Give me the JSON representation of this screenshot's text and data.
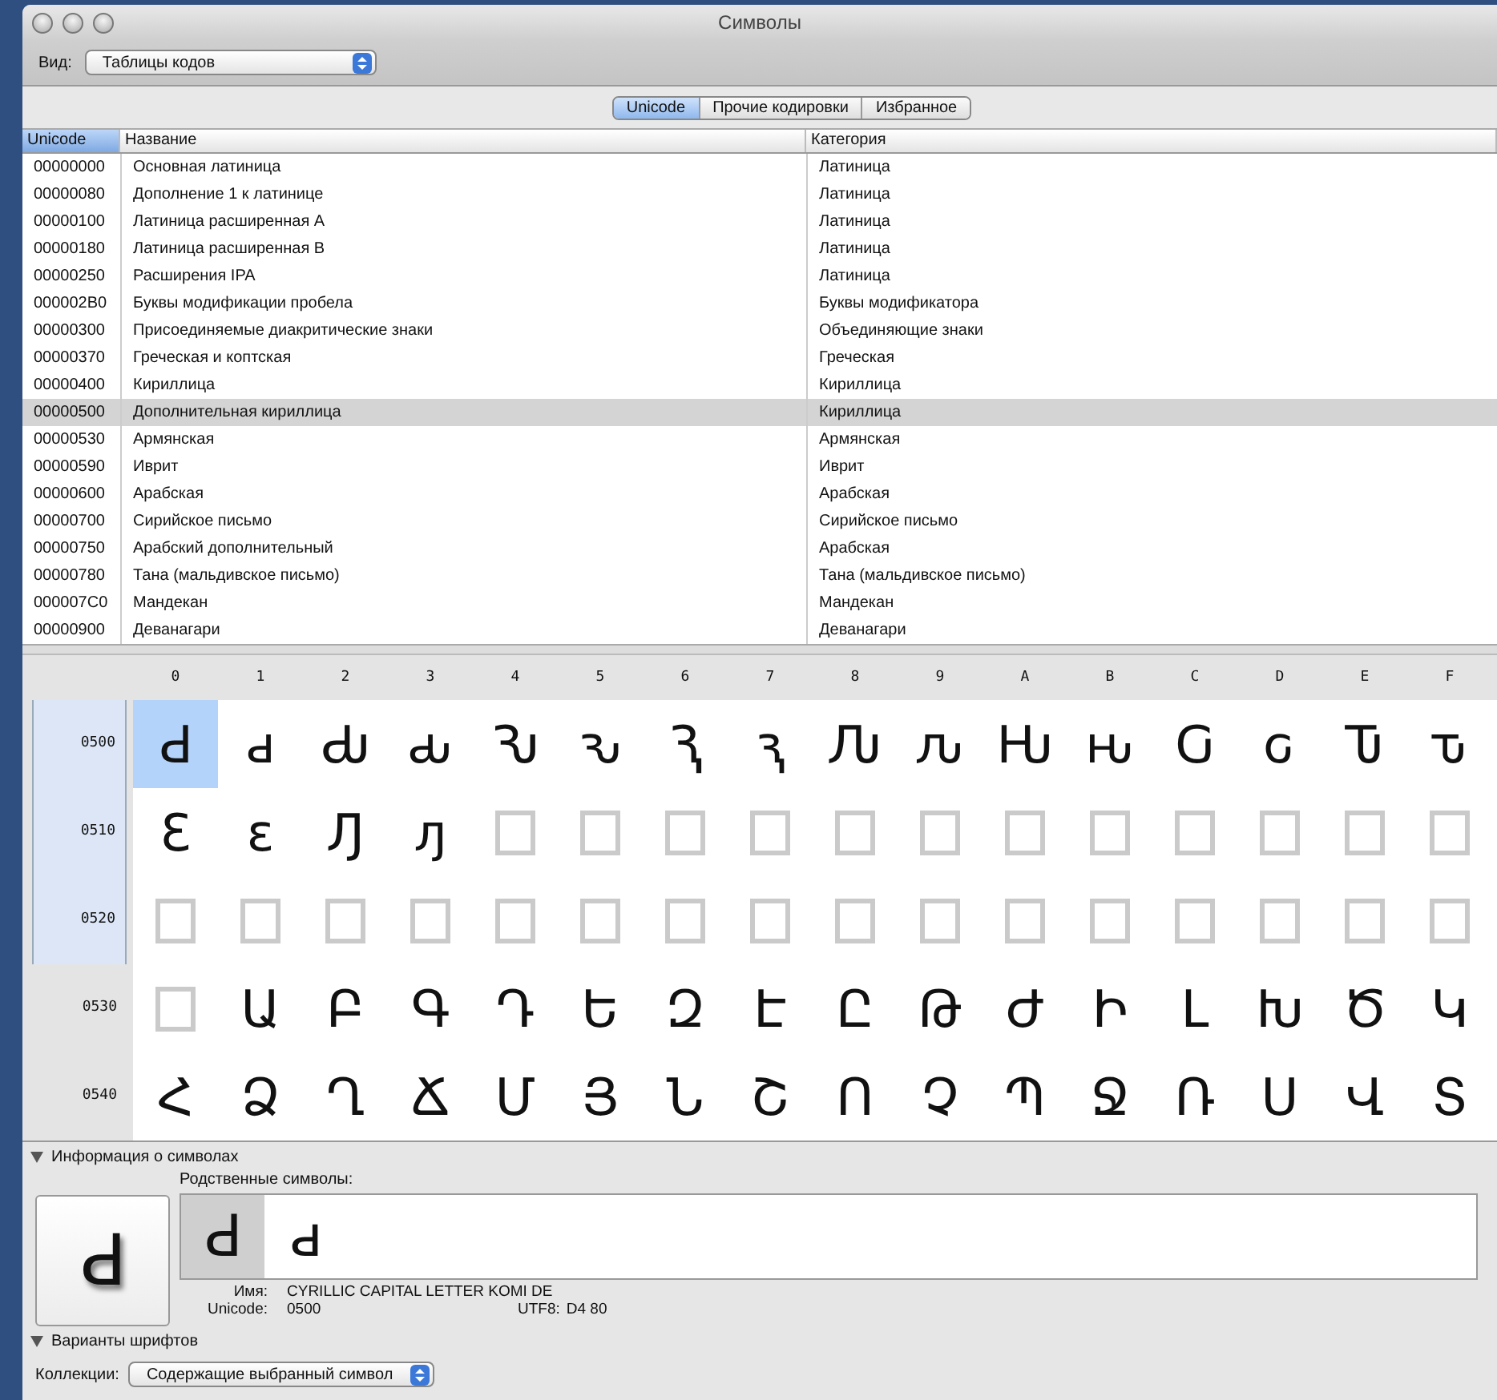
{
  "window": {
    "title": "Символы"
  },
  "view": {
    "label": "Вид:",
    "value": "Таблицы кодов"
  },
  "tabs": [
    {
      "label": "Unicode",
      "selected": true
    },
    {
      "label": "Прочие кодировки",
      "selected": false
    },
    {
      "label": "Избранное",
      "selected": false
    }
  ],
  "table": {
    "columns": [
      {
        "label": "Unicode",
        "selected": true
      },
      {
        "label": "Название",
        "selected": false
      },
      {
        "label": "Категория",
        "selected": false
      }
    ],
    "rows": [
      {
        "code": "00000000",
        "name": "Основная латиница",
        "category": "Латиница",
        "selected": false
      },
      {
        "code": "00000080",
        "name": "Дополнение 1 к латинице",
        "category": "Латиница",
        "selected": false
      },
      {
        "code": "00000100",
        "name": "Латиница расширенная A",
        "category": "Латиница",
        "selected": false
      },
      {
        "code": "00000180",
        "name": "Латиница расширенная B",
        "category": "Латиница",
        "selected": false
      },
      {
        "code": "00000250",
        "name": "Расширения IPA",
        "category": "Латиница",
        "selected": false
      },
      {
        "code": "000002B0",
        "name": "Буквы модификации пробела",
        "category": "Буквы модификатора",
        "selected": false
      },
      {
        "code": "00000300",
        "name": "Присоединяемые диакритические знаки",
        "category": "Объединяющие знаки",
        "selected": false
      },
      {
        "code": "00000370",
        "name": "Греческая и коптская",
        "category": "Греческая",
        "selected": false
      },
      {
        "code": "00000400",
        "name": "Кириллица",
        "category": "Кириллица",
        "selected": false
      },
      {
        "code": "00000500",
        "name": "Дополнительная кириллица",
        "category": "Кириллица",
        "selected": true
      },
      {
        "code": "00000530",
        "name": "Армянская",
        "category": "Армянская",
        "selected": false
      },
      {
        "code": "00000590",
        "name": "Иврит",
        "category": "Иврит",
        "selected": false
      },
      {
        "code": "00000600",
        "name": "Арабская",
        "category": "Арабская",
        "selected": false
      },
      {
        "code": "00000700",
        "name": "Сирийское письмо",
        "category": "Сирийское письмо",
        "selected": false
      },
      {
        "code": "00000750",
        "name": "Арабский дополнительный",
        "category": "Арабская",
        "selected": false
      },
      {
        "code": "00000780",
        "name": "Тана (мальдивское письмо)",
        "category": "Тана (мальдивское письмо)",
        "selected": false
      },
      {
        "code": "000007C0",
        "name": "Мандекан",
        "category": "Мандекан",
        "selected": false
      },
      {
        "code": "00000900",
        "name": "Деванагари",
        "category": "Деванагари",
        "selected": false
      }
    ]
  },
  "grid": {
    "column_labels": [
      "0",
      "1",
      "2",
      "3",
      "4",
      "5",
      "6",
      "7",
      "8",
      "9",
      "A",
      "B",
      "C",
      "D",
      "E",
      "F"
    ],
    "rows": [
      {
        "label": "0500",
        "selected": true,
        "cells": [
          {
            "kind": "glyph",
            "char": "Ԁ",
            "selected": true
          },
          {
            "kind": "glyph",
            "char": "ԁ",
            "selected": false
          },
          {
            "kind": "glyph",
            "char": "Ԃ",
            "selected": false
          },
          {
            "kind": "glyph",
            "char": "ԃ",
            "selected": false
          },
          {
            "kind": "glyph",
            "char": "Ԅ",
            "selected": false
          },
          {
            "kind": "glyph",
            "char": "ԅ",
            "selected": false
          },
          {
            "kind": "glyph",
            "char": "Ԇ",
            "selected": false
          },
          {
            "kind": "glyph",
            "char": "ԇ",
            "selected": false
          },
          {
            "kind": "glyph",
            "char": "Ԉ",
            "selected": false
          },
          {
            "kind": "glyph",
            "char": "ԉ",
            "selected": false
          },
          {
            "kind": "glyph",
            "char": "Ԋ",
            "selected": false
          },
          {
            "kind": "glyph",
            "char": "ԋ",
            "selected": false
          },
          {
            "kind": "glyph",
            "char": "Ԍ",
            "selected": false
          },
          {
            "kind": "glyph",
            "char": "ԍ",
            "selected": false
          },
          {
            "kind": "glyph",
            "char": "Ԏ",
            "selected": false
          },
          {
            "kind": "glyph",
            "char": "ԏ",
            "selected": false
          }
        ]
      },
      {
        "label": "0510",
        "selected": true,
        "cells": [
          {
            "kind": "glyph",
            "char": "Ԑ",
            "selected": false
          },
          {
            "kind": "glyph",
            "char": "ԑ",
            "selected": false
          },
          {
            "kind": "glyph",
            "char": "Ԓ",
            "selected": false
          },
          {
            "kind": "glyph",
            "char": "ԓ",
            "selected": false
          },
          {
            "kind": "missing",
            "selected": false
          },
          {
            "kind": "missing",
            "selected": false
          },
          {
            "kind": "missing",
            "selected": false
          },
          {
            "kind": "missing",
            "selected": false
          },
          {
            "kind": "missing",
            "selected": false
          },
          {
            "kind": "missing",
            "selected": false
          },
          {
            "kind": "missing",
            "selected": false
          },
          {
            "kind": "missing",
            "selected": false
          },
          {
            "kind": "missing",
            "selected": false
          },
          {
            "kind": "missing",
            "selected": false
          },
          {
            "kind": "missing",
            "selected": false
          },
          {
            "kind": "missing",
            "selected": false
          }
        ]
      },
      {
        "label": "0520",
        "selected": true,
        "cells": [
          {
            "kind": "missing",
            "selected": false
          },
          {
            "kind": "missing",
            "selected": false
          },
          {
            "kind": "missing",
            "selected": false
          },
          {
            "kind": "missing",
            "selected": false
          },
          {
            "kind": "missing",
            "selected": false
          },
          {
            "kind": "missing",
            "selected": false
          },
          {
            "kind": "missing",
            "selected": false
          },
          {
            "kind": "missing",
            "selected": false
          },
          {
            "kind": "missing",
            "selected": false
          },
          {
            "kind": "missing",
            "selected": false
          },
          {
            "kind": "missing",
            "selected": false
          },
          {
            "kind": "missing",
            "selected": false
          },
          {
            "kind": "missing",
            "selected": false
          },
          {
            "kind": "missing",
            "selected": false
          },
          {
            "kind": "missing",
            "selected": false
          },
          {
            "kind": "missing",
            "selected": false
          }
        ]
      },
      {
        "label": "0530",
        "selected": false,
        "cells": [
          {
            "kind": "missing",
            "selected": false
          },
          {
            "kind": "glyph",
            "char": "Ա",
            "selected": false
          },
          {
            "kind": "glyph",
            "char": "Բ",
            "selected": false
          },
          {
            "kind": "glyph",
            "char": "Գ",
            "selected": false
          },
          {
            "kind": "glyph",
            "char": "Դ",
            "selected": false
          },
          {
            "kind": "glyph",
            "char": "Ե",
            "selected": false
          },
          {
            "kind": "glyph",
            "char": "Զ",
            "selected": false
          },
          {
            "kind": "glyph",
            "char": "Է",
            "selected": false
          },
          {
            "kind": "glyph",
            "char": "Ը",
            "selected": false
          },
          {
            "kind": "glyph",
            "char": "Թ",
            "selected": false
          },
          {
            "kind": "glyph",
            "char": "Ժ",
            "selected": false
          },
          {
            "kind": "glyph",
            "char": "Ի",
            "selected": false
          },
          {
            "kind": "glyph",
            "char": "Լ",
            "selected": false
          },
          {
            "kind": "glyph",
            "char": "Խ",
            "selected": false
          },
          {
            "kind": "glyph",
            "char": "Ծ",
            "selected": false
          },
          {
            "kind": "glyph",
            "char": "Կ",
            "selected": false
          }
        ]
      },
      {
        "label": "0540",
        "selected": false,
        "cells": [
          {
            "kind": "glyph",
            "char": "Հ",
            "selected": false
          },
          {
            "kind": "glyph",
            "char": "Ձ",
            "selected": false
          },
          {
            "kind": "glyph",
            "char": "Ղ",
            "selected": false
          },
          {
            "kind": "glyph",
            "char": "Ճ",
            "selected": false
          },
          {
            "kind": "glyph",
            "char": "Մ",
            "selected": false
          },
          {
            "kind": "glyph",
            "char": "Յ",
            "selected": false
          },
          {
            "kind": "glyph",
            "char": "Ն",
            "selected": false
          },
          {
            "kind": "glyph",
            "char": "Շ",
            "selected": false
          },
          {
            "kind": "glyph",
            "char": "Ո",
            "selected": false
          },
          {
            "kind": "glyph",
            "char": "Չ",
            "selected": false
          },
          {
            "kind": "glyph",
            "char": "Պ",
            "selected": false
          },
          {
            "kind": "glyph",
            "char": "Ջ",
            "selected": false
          },
          {
            "kind": "glyph",
            "char": "Ռ",
            "selected": false
          },
          {
            "kind": "glyph",
            "char": "Ս",
            "selected": false
          },
          {
            "kind": "glyph",
            "char": "Վ",
            "selected": false
          },
          {
            "kind": "glyph",
            "char": "Տ",
            "selected": false
          }
        ]
      }
    ]
  },
  "info": {
    "title": "Информация о символах",
    "expanded": true,
    "preview": "Ԁ",
    "related_label": "Родственные символы:",
    "related": [
      {
        "char": "Ԁ",
        "selected": true
      },
      {
        "char": "ԁ",
        "selected": false
      }
    ],
    "name_label": "Имя:",
    "name": "CYRILLIC CAPITAL LETTER KOMI DE",
    "unicode_label": "Unicode:",
    "unicode": "0500",
    "utf8_label": "UTF8:",
    "utf8": "D4 80"
  },
  "font_variants": {
    "title": "Варианты шрифтов",
    "expanded": true
  },
  "collections": {
    "label": "Коллекции:",
    "value": "Содержащие выбранный символ"
  }
}
